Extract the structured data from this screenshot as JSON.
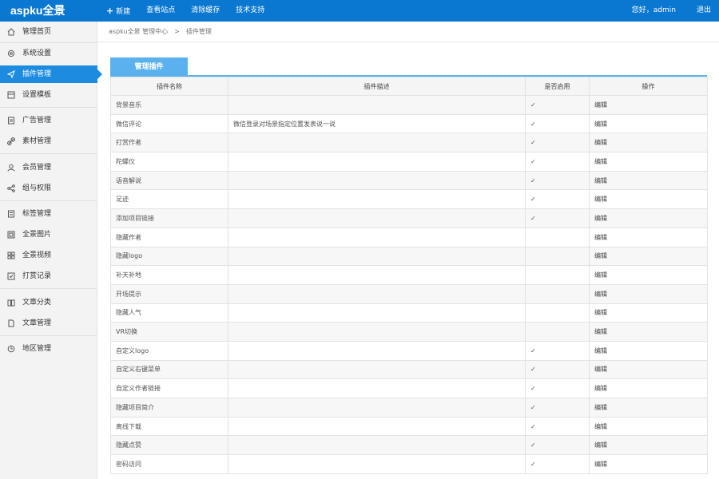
{
  "app": {
    "logo": "aspku全景",
    "top_nav": [
      {
        "label": "新建",
        "icon": "plus-icon"
      },
      {
        "label": "查看站点"
      },
      {
        "label": "清除缓存"
      },
      {
        "label": "技术支持"
      }
    ],
    "greeting": "您好，admin",
    "logout": "退出"
  },
  "sidebar": {
    "items": [
      {
        "label": "管理首页",
        "icon": "home-icon"
      },
      {
        "label": "系统设置",
        "icon": "gear-icon"
      },
      {
        "label": "插件管理",
        "icon": "send-icon",
        "active": true
      },
      {
        "label": "设置模板",
        "icon": "template-icon"
      },
      {
        "label": "广告管理",
        "icon": "ad-icon"
      },
      {
        "label": "素材管理",
        "icon": "link-icon"
      },
      {
        "label": "会员管理",
        "icon": "user-icon"
      },
      {
        "label": "组与权限",
        "icon": "share-icon"
      },
      {
        "label": "标签管理",
        "icon": "tag-icon"
      },
      {
        "label": "全景图片",
        "icon": "image-icon"
      },
      {
        "label": "全景视频",
        "icon": "grid-icon"
      },
      {
        "label": "打赏记录",
        "icon": "record-icon"
      },
      {
        "label": "文章分类",
        "icon": "book-icon"
      },
      {
        "label": "文章管理",
        "icon": "document-icon"
      },
      {
        "label": "地区管理",
        "icon": "region-icon"
      }
    ]
  },
  "breadcrumb": {
    "home": "aspku全景 管理中心",
    "separator": ">",
    "current": "插件管理"
  },
  "tab": {
    "label": "管理插件"
  },
  "table": {
    "headers": [
      "插件名称",
      "插件描述",
      "是否启用",
      "操作"
    ],
    "rows": [
      {
        "name": "背景音乐",
        "desc": "",
        "enabled": true,
        "action": "编辑"
      },
      {
        "name": "微信评论",
        "desc": "微信登录对场景指定位置发表说一说",
        "enabled": true,
        "action": "编辑"
      },
      {
        "name": "打赏作者",
        "desc": "",
        "enabled": true,
        "action": "编辑"
      },
      {
        "name": "陀螺仪",
        "desc": "",
        "enabled": true,
        "action": "编辑"
      },
      {
        "name": "语音解说",
        "desc": "",
        "enabled": true,
        "action": "编辑"
      },
      {
        "name": "足迹",
        "desc": "",
        "enabled": true,
        "action": "编辑"
      },
      {
        "name": "添加项目链接",
        "desc": "",
        "enabled": true,
        "action": "编辑"
      },
      {
        "name": "隐藏作者",
        "desc": "",
        "enabled": false,
        "action": "编辑"
      },
      {
        "name": "隐藏logo",
        "desc": "",
        "enabled": false,
        "action": "编辑"
      },
      {
        "name": "补天补地",
        "desc": "",
        "enabled": false,
        "action": "编辑"
      },
      {
        "name": "开场提示",
        "desc": "",
        "enabled": false,
        "action": "编辑"
      },
      {
        "name": "隐藏人气",
        "desc": "",
        "enabled": false,
        "action": "编辑"
      },
      {
        "name": "VR切换",
        "desc": "",
        "enabled": false,
        "action": "编辑"
      },
      {
        "name": "自定义logo",
        "desc": "",
        "enabled": true,
        "action": "编辑"
      },
      {
        "name": "自定义右键菜单",
        "desc": "",
        "enabled": true,
        "action": "编辑"
      },
      {
        "name": "自定义作者链接",
        "desc": "",
        "enabled": true,
        "action": "编辑"
      },
      {
        "name": "隐藏项目简介",
        "desc": "",
        "enabled": true,
        "action": "编辑"
      },
      {
        "name": "离线下载",
        "desc": "",
        "enabled": true,
        "action": "编辑"
      },
      {
        "name": "隐藏点赞",
        "desc": "",
        "enabled": true,
        "action": "编辑"
      },
      {
        "name": "密码访问",
        "desc": "",
        "enabled": true,
        "action": "编辑"
      }
    ],
    "check_glyph": "✓"
  },
  "colors": {
    "topbar": "#0a78d1",
    "active": "#1d8ce0",
    "tab": "#5ab1ee",
    "check": "#2f9b35"
  }
}
